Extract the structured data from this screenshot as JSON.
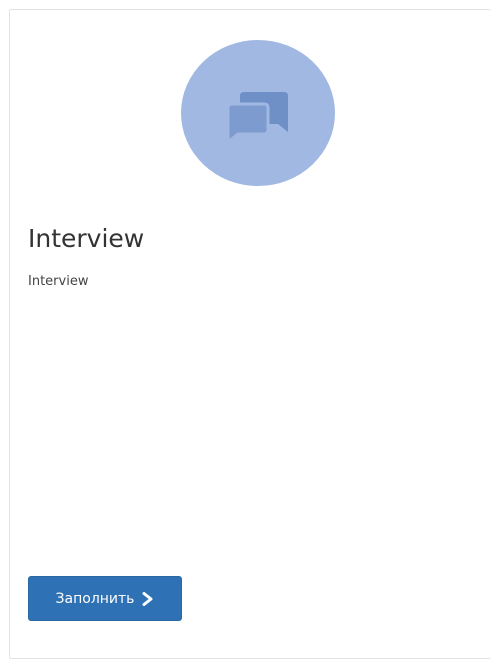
{
  "card": {
    "title": "Interview",
    "description": "Interview",
    "icon": "chat-bubbles-icon",
    "button": {
      "label": "Заполнить",
      "icon": "chevron-right-icon"
    }
  },
  "colors": {
    "avatar_bg": "#a0b8e2",
    "avatar_icon": "#6f8fc7",
    "button_bg": "#2e72b5",
    "title_text": "#333333"
  }
}
